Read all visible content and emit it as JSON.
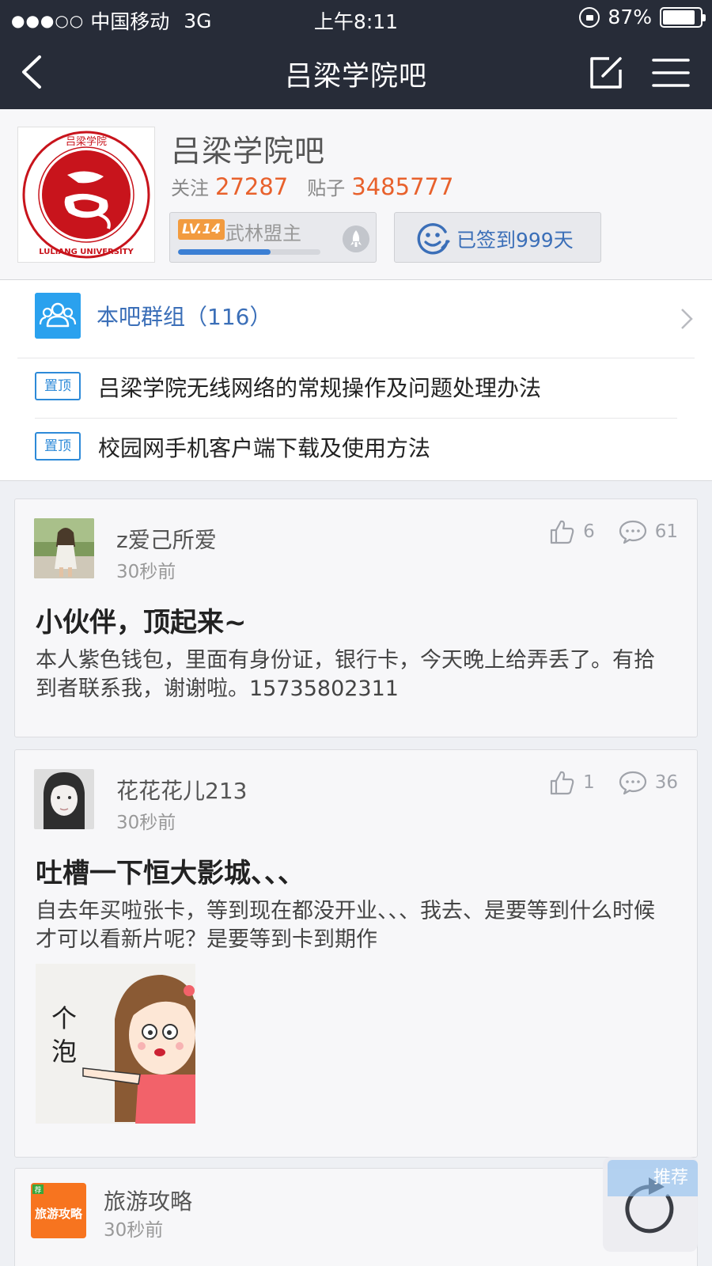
{
  "status_bar": {
    "signal": "●●●○○",
    "carrier": "中国移动",
    "network": "3G",
    "time": "上午8:11",
    "battery": "87%",
    "battery_level": 0.87
  },
  "nav": {
    "title": "吕梁学院吧"
  },
  "forum": {
    "name": "吕梁学院吧",
    "logo_text": "LULIANG UNIVERSITY",
    "logo_seal_text": "吕梁学院",
    "follow_label": "关注",
    "follow_count": "27287",
    "posts_label": "贴子",
    "posts_count": "3485777",
    "level_badge": "LV.14",
    "level_title": "武林盟主",
    "level_progress": 0.65,
    "signin_label": "已签到999天"
  },
  "pinned": {
    "group_label": "本吧群组（116）",
    "top_items": [
      {
        "badge": "置顶",
        "title": "吕梁学院无线网络的常规操作及问题处理办法"
      },
      {
        "badge": "置顶",
        "title": "校园网手机客户端下载及使用方法"
      }
    ]
  },
  "posts": [
    {
      "username": "z爱己所爱",
      "time": "30秒前",
      "likes": "6",
      "comments": "61",
      "title": "小伙伴，顶起来~",
      "body": "本人紫色钱包，里面有身份证，银行卡，今天晚上给弄丢了。有拾到者联系我，谢谢啦。15735802311"
    },
    {
      "username": "花花花儿213",
      "time": "30秒前",
      "likes": "1",
      "comments": "36",
      "title": "吐槽一下恒大影城、、、",
      "body": "自去年买啦张卡，等到现在都没开业、、、我去、是要等到什么时候才可以看新片呢？是要等到卡到期作",
      "image_text_1": "个",
      "image_text_2": "泡"
    },
    {
      "username": "旅游攻略",
      "time": "30秒前",
      "avatar_text": "旅游攻略",
      "avatar_tag": "荐"
    }
  ],
  "fab": {
    "tab_label": "推荐"
  },
  "colors": {
    "nav_bg": "#272c38",
    "accent_orange": "#e8612c",
    "link_blue": "#3b6fb8",
    "group_icon_blue": "#2aa1ee"
  }
}
